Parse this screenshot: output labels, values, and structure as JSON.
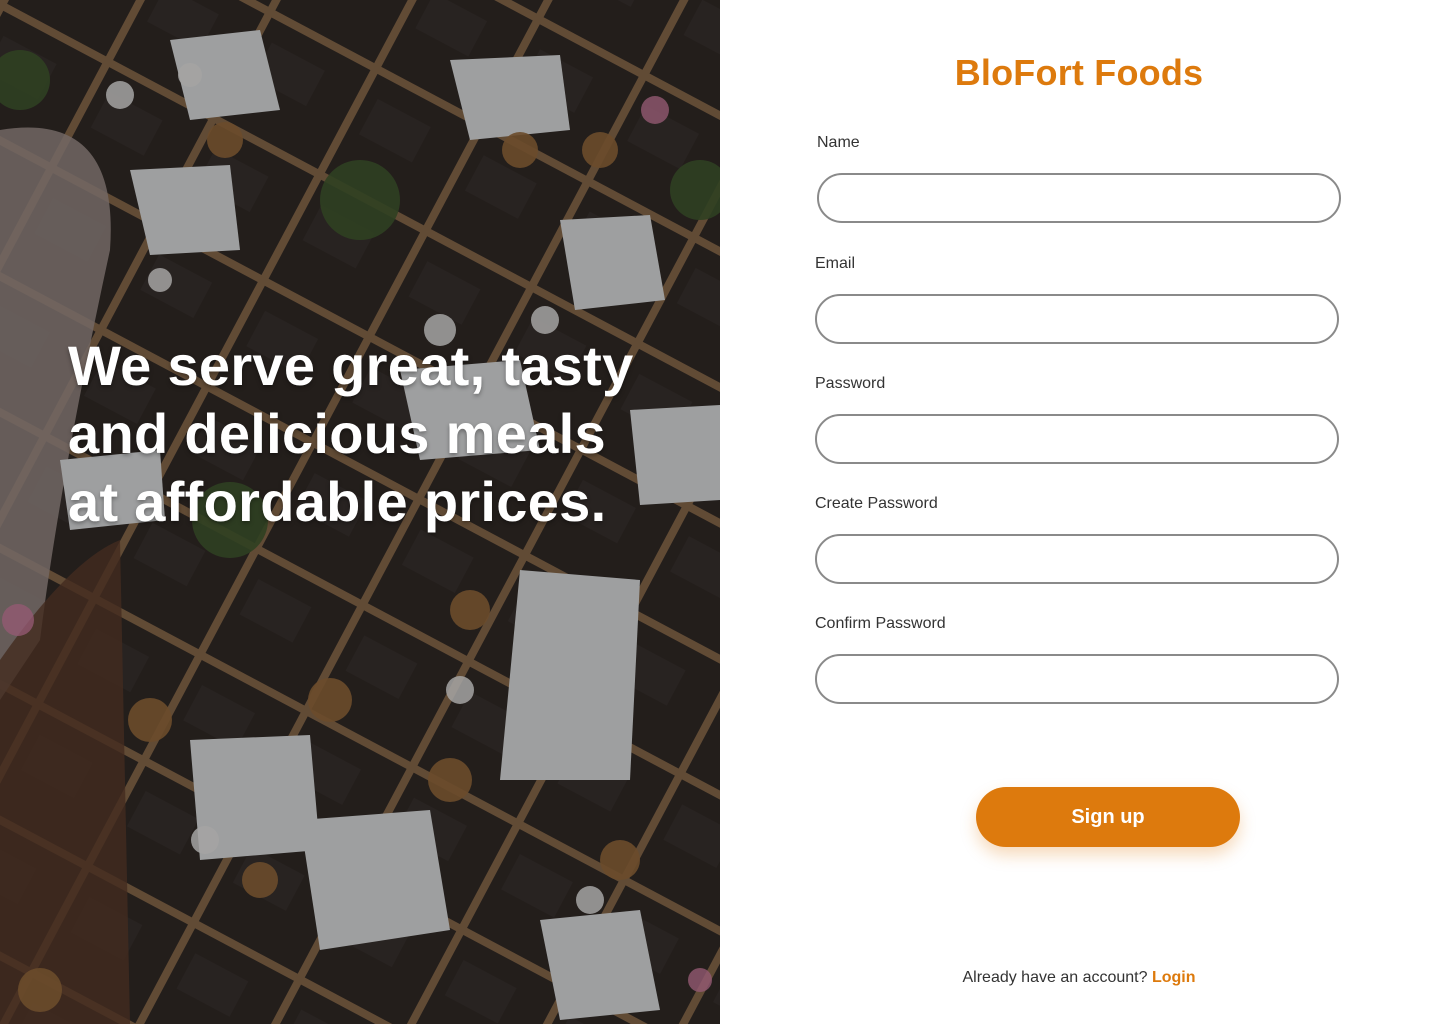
{
  "hero": {
    "tagline": "We serve great, tasty and delicious meals at affordable prices."
  },
  "brand": {
    "name": "BloFort Foods",
    "accent_color": "#dd7a0d"
  },
  "form": {
    "fields": [
      {
        "label": "Name",
        "value": "",
        "placeholder": ""
      },
      {
        "label": "Email",
        "value": "",
        "placeholder": ""
      },
      {
        "label": "Password",
        "value": "",
        "placeholder": ""
      },
      {
        "label": "Create Password",
        "value": "",
        "placeholder": ""
      },
      {
        "label": "Confirm Password",
        "value": "",
        "placeholder": ""
      }
    ],
    "submit_label": "Sign up"
  },
  "footer": {
    "prompt": "Already have an account?",
    "login_label": "Login"
  }
}
